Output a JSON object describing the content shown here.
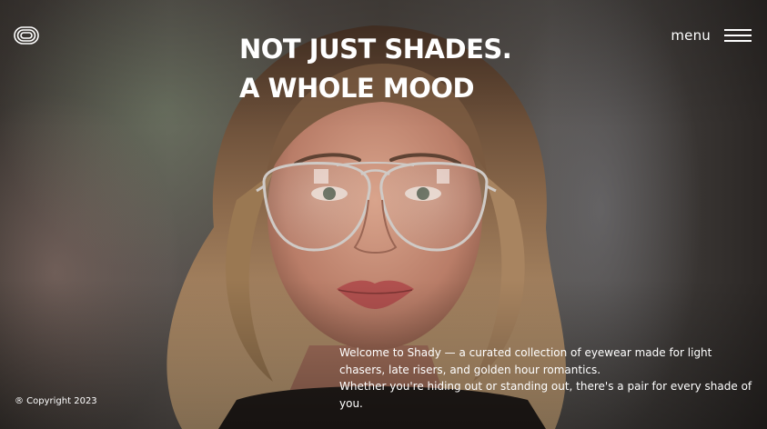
{
  "header": {
    "logo_icon": "concentric-rounded-rectangles-logo",
    "headline_line1": "NOT JUST SHADES.",
    "headline_line2": "A WHOLE MOOD",
    "menu_label": "menu",
    "menu_icon": "hamburger-icon"
  },
  "hero": {
    "image_subject": "portrait of a young woman wearing clear aviator eyeglasses"
  },
  "footer": {
    "copyright": "® Copyright 2023",
    "welcome_line1": "Welcome to Shady — a curated collection of eyewear made for light chasers, late risers, and golden hour romantics.",
    "welcome_line2": " Whether you're hiding out or standing out, there's a pair for every shade of you."
  },
  "colors": {
    "text": "#ffffff",
    "background": "#2a2622"
  }
}
